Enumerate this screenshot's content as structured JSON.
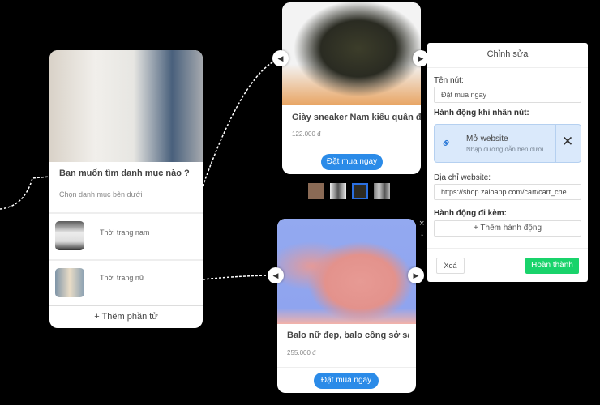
{
  "category_card": {
    "title": "Bạn muốn tìm danh mục nào ?",
    "subtitle": "Chọn danh mục bên dưới",
    "items": [
      {
        "label": "Thời trang nam"
      },
      {
        "label": "Thời trang nữ"
      }
    ],
    "add_label": "Thêm phần tử"
  },
  "product_top": {
    "title": "Giày sneaker Nam kiểu quân đội",
    "price": "122.000 đ",
    "button": "Đặt mua ngay",
    "selected_thumb": 3
  },
  "product_bottom": {
    "title": "Balo nữ đẹp, balo công sở sang t",
    "price": "255.000 đ",
    "button": "Đặt mua ngay"
  },
  "edit_panel": {
    "header": "Chỉnh sửa",
    "name_label": "Tên nút:",
    "name_value": "Đặt mua ngay",
    "action_label": "Hành động khi nhấn nút:",
    "action_title": "Mở website",
    "action_hint": "Nhập đường dẫn bên dưới",
    "url_label": "Địa chỉ website:",
    "url_value": "https://shop.zaloapp.com/cart/cart_che",
    "extra_label": "Hành động đi kèm:",
    "add_action": "Thêm hành động",
    "delete": "Xoá",
    "done": "Hoàn thành"
  },
  "colors": {
    "primary": "#2b8be8",
    "done": "#19d36b",
    "action_bg": "#dae9fb"
  }
}
